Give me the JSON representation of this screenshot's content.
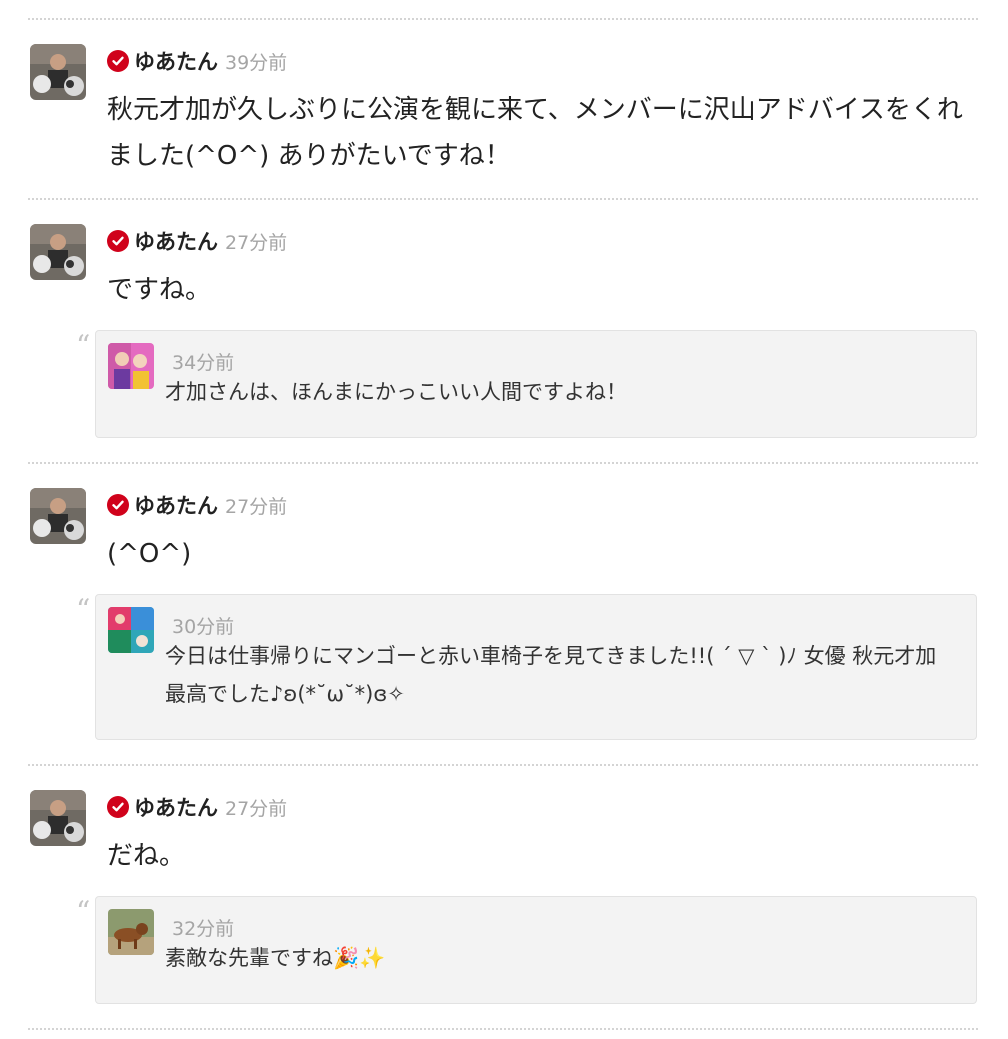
{
  "colors": {
    "verified_badge": "#d0021b",
    "timestamp": "#a5a5a5",
    "quote_background": "#f3f3f3",
    "separator": "#d4d4d4"
  },
  "icons": {
    "verified": "verified-check-icon",
    "quote": "quote-mark-icon"
  },
  "comments": [
    {
      "author": "ゆあたん",
      "time": "39分前",
      "text": "秋元才加が久しぶりに公演を観に来て、メンバーに沢山アドバイスをくれました(^O^) ありがたいですね！"
    },
    {
      "author": "ゆあたん",
      "time": "27分前",
      "text": "ですね。",
      "quote": {
        "quote_mark": "“",
        "time": "34分前",
        "text": "才加さんは、ほんまにかっこいい人間ですよね！"
      }
    },
    {
      "author": "ゆあたん",
      "time": "27分前",
      "text": "(^O^)",
      "quote": {
        "quote_mark": "“",
        "time": "30分前",
        "text": "今日は仕事帰りにマンゴーと赤い車椅子を見てきました!!( ´ ▽ ` )ﾉ 女優 秋元才加 最高でした♪ʚ(*˘ω˘*)ɞ✧"
      }
    },
    {
      "author": "ゆあたん",
      "time": "27分前",
      "text": "だね。",
      "quote": {
        "quote_mark": "“",
        "time": "32分前",
        "text": "素敵な先輩ですね🎉✨"
      }
    }
  ]
}
